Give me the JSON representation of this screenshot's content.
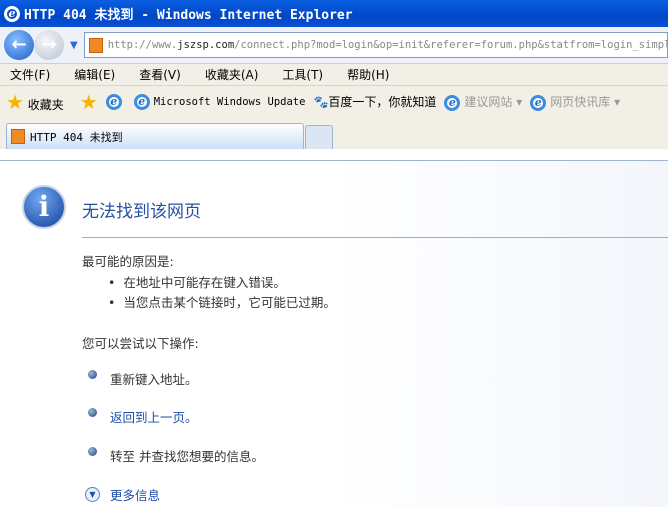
{
  "window": {
    "title": "HTTP 404 未找到 - Windows Internet Explorer"
  },
  "address": {
    "prefix": "http://www.",
    "domain": "jszsp.com",
    "path": "/connect.php?mod=login&op=init&referer=forum.php&statfrom=login_simple"
  },
  "menu": [
    "文件(F)",
    "编辑(E)",
    "查看(V)",
    "收藏夹(A)",
    "工具(T)",
    "帮助(H)"
  ],
  "links": {
    "favorites": "收藏夹",
    "ms_update": "Microsoft Windows Update",
    "baidu": "百度一下，你就知道",
    "suggested": "建议网站",
    "webslice": "网页快讯库"
  },
  "tab": {
    "title": "HTTP 404 未找到"
  },
  "content": {
    "heading": "无法找到该网页",
    "cause_label": "最可能的原因是:",
    "causes": [
      "在地址中可能存在键入错误。",
      "当您点击某个链接时，它可能已过期。"
    ],
    "try_label": "您可以尝试以下操作:",
    "actions": [
      "重新键入地址。",
      "返回到上一页。",
      "转至  并查找您想要的信息。"
    ],
    "more": "更多信息"
  }
}
